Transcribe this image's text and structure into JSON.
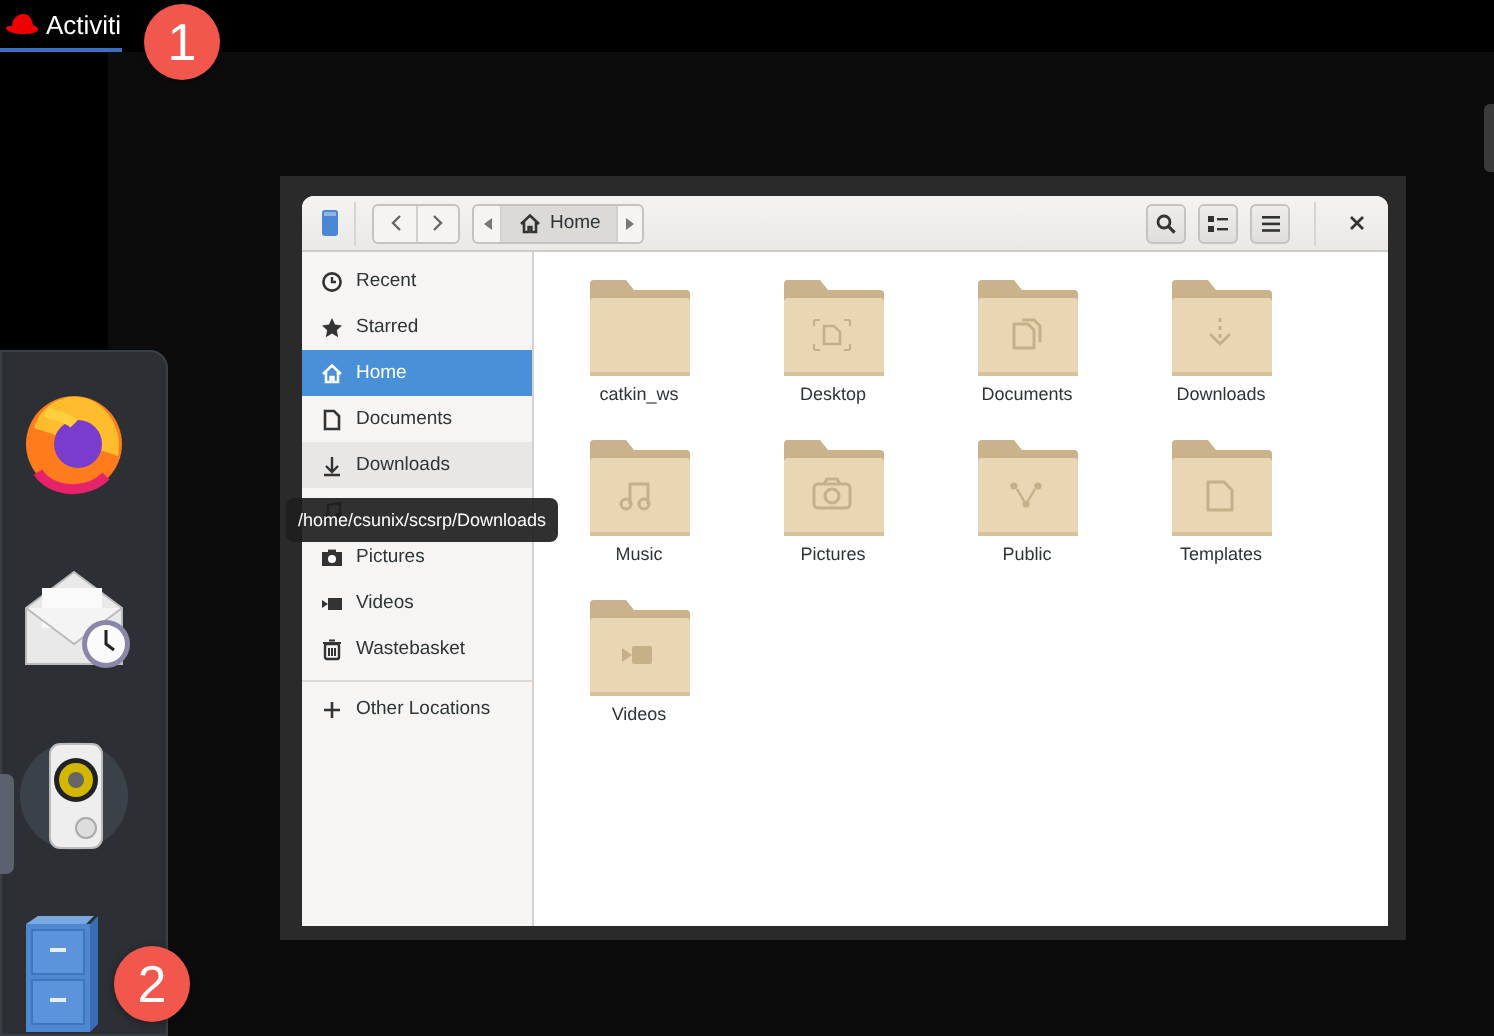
{
  "top_bar": {
    "activities": "Activiti"
  },
  "dock": {
    "apps": [
      {
        "kind": "browser"
      },
      {
        "kind": "mail-clock"
      },
      {
        "kind": "speaker"
      },
      {
        "kind": "files"
      }
    ]
  },
  "file_manager": {
    "path": "Home",
    "sidebar": [
      {
        "label": "Recent",
        "selected": false,
        "hovered": false
      },
      {
        "label": "Starred",
        "selected": false,
        "hovered": false
      },
      {
        "label": "Home",
        "selected": true,
        "hovered": false
      },
      {
        "label": "Documents",
        "selected": false,
        "hovered": false
      },
      {
        "label": "Downloads",
        "selected": false,
        "hovered": true
      },
      {
        "selected": false,
        "hovered": false
      },
      {
        "label": "Pictures",
        "selected": false,
        "hovered": false
      },
      {
        "label": "Videos",
        "selected": false,
        "hovered": false
      },
      {
        "label": "Wastebasket",
        "selected": false,
        "hovered": false
      },
      {
        "label": "Other Locations",
        "selected": false,
        "hovered": false
      }
    ],
    "folders": [
      {
        "name": "catkin_ws",
        "kind": "plain"
      },
      {
        "name": "Desktop",
        "kind": "desktop"
      },
      {
        "name": "Documents",
        "kind": "documents"
      },
      {
        "name": "Downloads",
        "kind": "downloads"
      },
      {
        "name": "Music",
        "kind": "music"
      },
      {
        "name": "Pictures",
        "kind": "pictures"
      },
      {
        "name": "Public",
        "kind": "public"
      },
      {
        "name": "Templates",
        "kind": "templates"
      },
      {
        "name": "Videos",
        "kind": "videos"
      }
    ],
    "tooltip": "/home/csunix/scsrp/Downloads"
  },
  "annotations": [
    {
      "label": "1"
    },
    {
      "label": "2"
    }
  ]
}
